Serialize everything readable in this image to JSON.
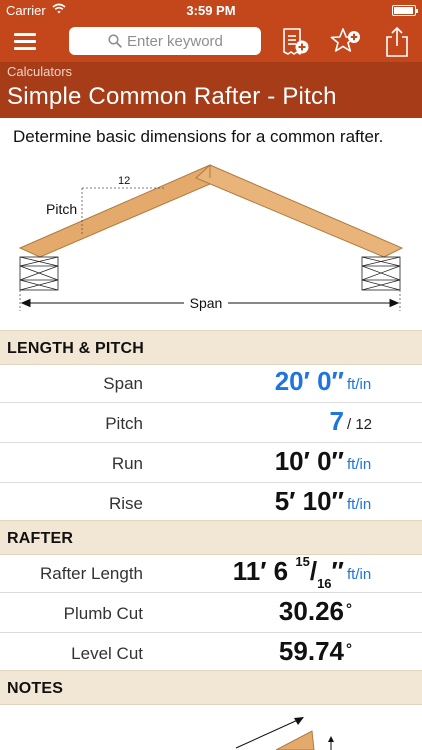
{
  "status_bar": {
    "carrier": "Carrier",
    "time": "3:59 PM",
    "battery_level": 0.95
  },
  "search": {
    "placeholder": "Enter keyword"
  },
  "title_bar": {
    "breadcrumb": "Calculators",
    "title": "Simple Common Rafter - Pitch"
  },
  "description": "Determine basic dimensions for a common rafter.",
  "diagram": {
    "pitch_label": "Pitch",
    "rise_per": "12",
    "span_label": "Span"
  },
  "sections": {
    "length_pitch": {
      "header": "LENGTH & PITCH",
      "span": {
        "label": "Span",
        "value": "20′ 0″",
        "unit": "ft/in"
      },
      "pitch": {
        "label": "Pitch",
        "value": "7",
        "unit": "/ 12"
      },
      "run": {
        "label": "Run",
        "value": "10′ 0″",
        "unit": "ft/in"
      },
      "rise": {
        "label": "Rise",
        "value": "5′ 10″",
        "unit": "ft/in"
      }
    },
    "rafter": {
      "header": "RAFTER",
      "rafter_length": {
        "label": "Rafter Length",
        "whole": "11′ 6 ",
        "num": "15",
        "den": "16",
        "inch": "″",
        "unit": "ft/in"
      },
      "plumb_cut": {
        "label": "Plumb Cut",
        "value": "30.26",
        "unit": "°"
      },
      "level_cut": {
        "label": "Level Cut",
        "value": "59.74",
        "unit": "°"
      }
    },
    "notes": {
      "header": "NOTES"
    }
  },
  "colors": {
    "brand": "#c4471c",
    "title_bar": "#a63c18",
    "accent_blue": "#1f74dd",
    "section_bg": "#f2e7d4",
    "wood": "#e3aa6c"
  }
}
